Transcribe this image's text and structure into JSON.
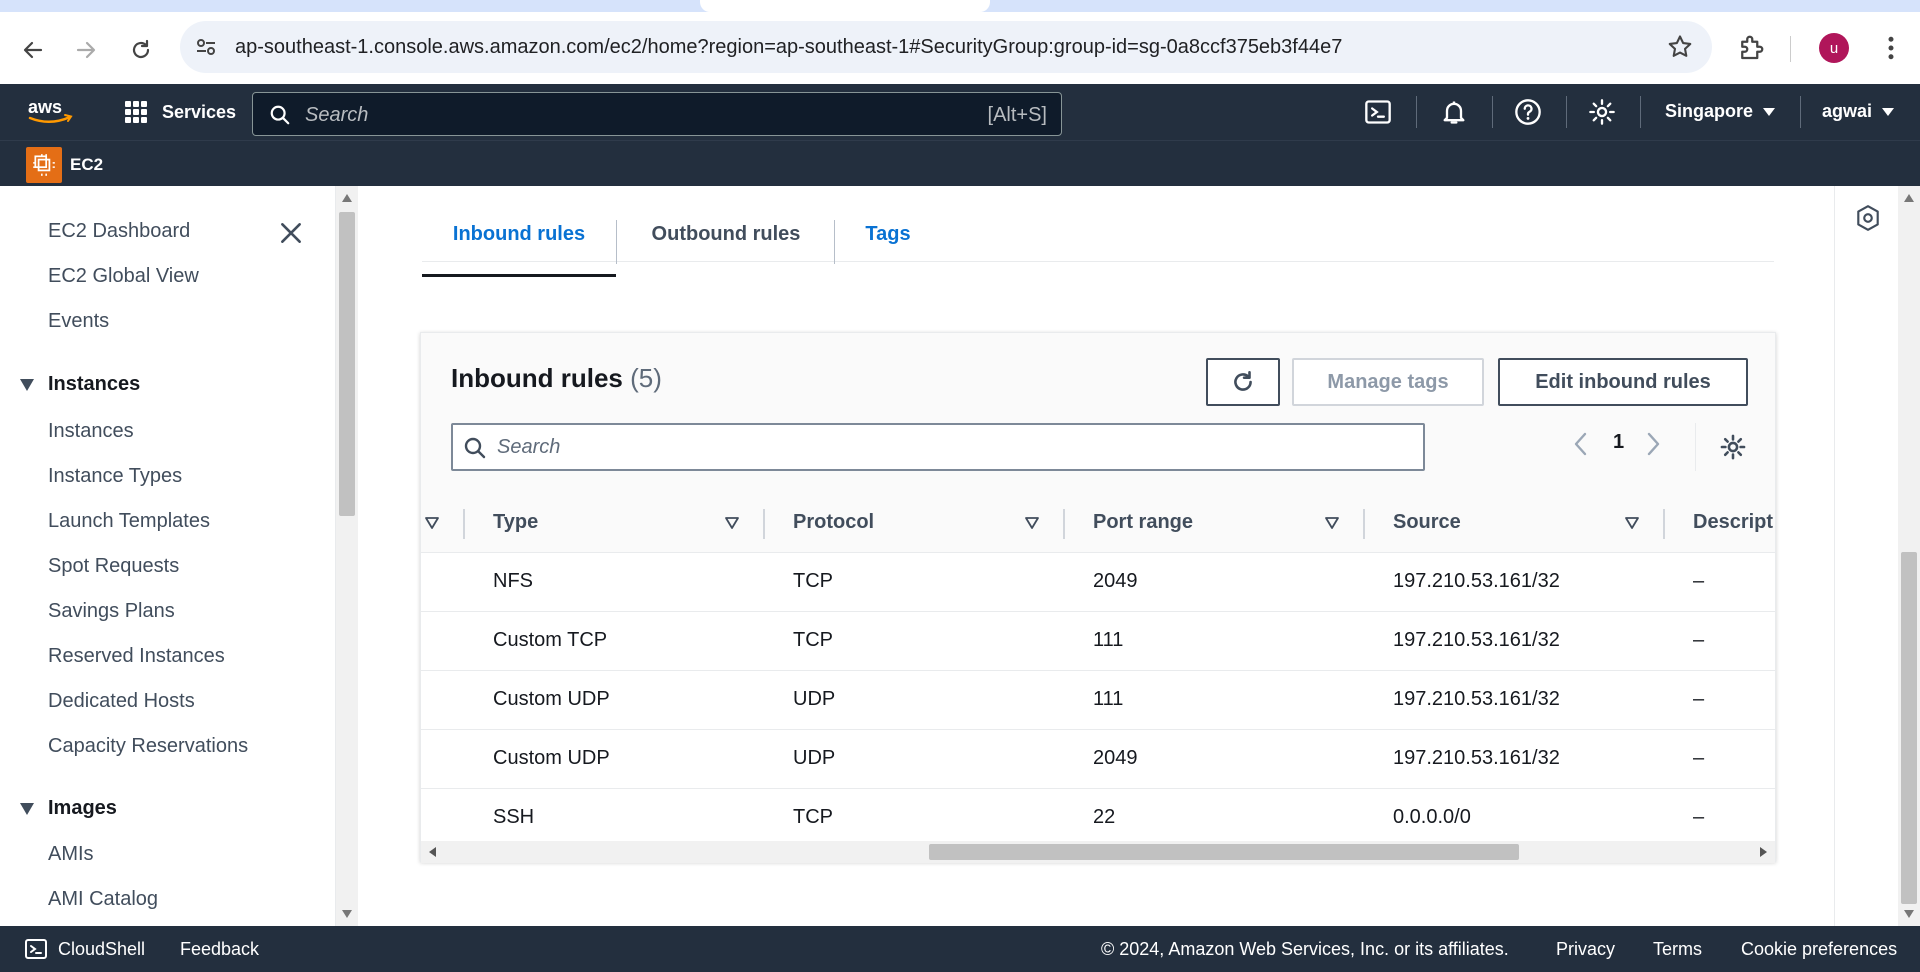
{
  "browser": {
    "url": "ap-southeast-1.console.aws.amazon.com/ec2/home?region=ap-southeast-1#SecurityGroup:group-id=sg-0a8ccf375eb3f44e7",
    "profile_initial": "u"
  },
  "header": {
    "services_label": "Services",
    "search_placeholder": "Search",
    "search_shortcut": "[Alt+S]",
    "region": "Singapore",
    "user": "agwai",
    "service_name": "EC2"
  },
  "sidebar": {
    "top_items": [
      "EC2 Dashboard",
      "EC2 Global View",
      "Events"
    ],
    "sections": [
      {
        "title": "Instances",
        "items": [
          "Instances",
          "Instance Types",
          "Launch Templates",
          "Spot Requests",
          "Savings Plans",
          "Reserved Instances",
          "Dedicated Hosts",
          "Capacity Reservations"
        ]
      },
      {
        "title": "Images",
        "items": [
          "AMIs",
          "AMI Catalog"
        ]
      }
    ]
  },
  "tabs": [
    {
      "label": "Inbound rules",
      "active": true
    },
    {
      "label": "Outbound rules",
      "active": false
    },
    {
      "label": "Tags",
      "active": false
    }
  ],
  "panel": {
    "title": "Inbound rules",
    "count": "(5)",
    "manage_tags_label": "Manage tags",
    "edit_label": "Edit inbound rules",
    "search_placeholder": "Search",
    "page": "1"
  },
  "table": {
    "columns": [
      "Type",
      "Protocol",
      "Port range",
      "Source",
      "Descript"
    ],
    "rows": [
      [
        "NFS",
        "TCP",
        "2049",
        "197.210.53.161/32",
        "–"
      ],
      [
        "Custom TCP",
        "TCP",
        "111",
        "197.210.53.161/32",
        "–"
      ],
      [
        "Custom UDP",
        "UDP",
        "111",
        "197.210.53.161/32",
        "–"
      ],
      [
        "Custom UDP",
        "UDP",
        "2049",
        "197.210.53.161/32",
        "–"
      ],
      [
        "SSH",
        "TCP",
        "22",
        "0.0.0.0/0",
        "–"
      ]
    ]
  },
  "footer": {
    "cloudshell": "CloudShell",
    "feedback": "Feedback",
    "copyright": "© 2024, Amazon Web Services, Inc. or its affiliates.",
    "privacy": "Privacy",
    "terms": "Terms",
    "cookie": "Cookie preferences"
  },
  "colors": {
    "aws_nav": "#232f3e",
    "link_blue": "#0972d3",
    "ec2_orange": "#e46e16",
    "profile": "#b0165a"
  }
}
